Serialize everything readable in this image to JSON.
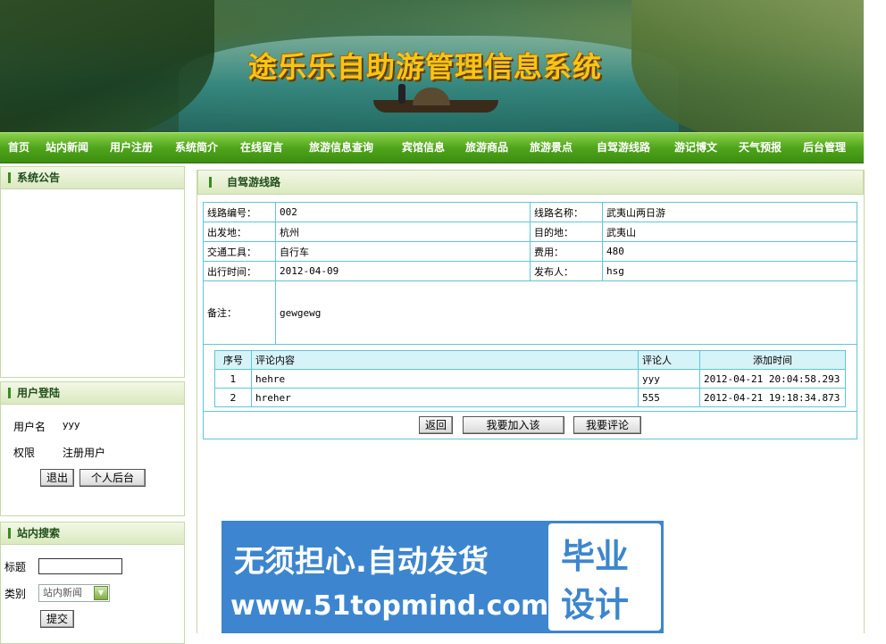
{
  "banner": {
    "title": "途乐乐自助游管理信息系统"
  },
  "nav": [
    "首页",
    "站内新闻",
    "用户注册",
    "系统简介",
    "在线留言",
    "旅游信息查询",
    "宾馆信息",
    "旅游商品",
    "旅游景点",
    "自驾游线路",
    "游记博文",
    "天气预报",
    "后台管理"
  ],
  "notice": {
    "title": "系统公告"
  },
  "login": {
    "title": "用户登陆",
    "username_label": "用户名",
    "username_value": "yyy",
    "role_label": "权限",
    "role_value": "注册用户",
    "logout_btn": "退出",
    "backend_btn": "个人后台"
  },
  "search": {
    "title": "站内搜索",
    "title_label": "标题",
    "type_label": "类别",
    "type_value": "站内新闻",
    "submit_btn": "提交"
  },
  "detail": {
    "title": "自驾游线路",
    "route_no_label": "线路编号：",
    "route_no": "002",
    "route_name_label": "线路名称：",
    "route_name": "武夷山两日游",
    "from_label": "出发地：",
    "from": "杭州",
    "to_label": "目的地：",
    "to": "武夷山",
    "vehicle_label": "交通工具：",
    "vehicle": "自行车",
    "cost_label": "费用：",
    "cost": "480",
    "date_label": "出行时间：",
    "date": "2012-04-09",
    "publisher_label": "发布人：",
    "publisher": "hsg",
    "remark_label": "备注：",
    "remark": "gewgewg"
  },
  "comments": {
    "headers": {
      "no": "序号",
      "content": "评论内容",
      "user": "评论人",
      "time": "添加时间"
    },
    "rows": [
      {
        "no": "1",
        "content": "hehre",
        "user": "yyy",
        "time": "2012-04-21 20:04:58.293"
      },
      {
        "no": "2",
        "content": "hreher",
        "user": "555",
        "time": "2012-04-21 19:18:34.873"
      }
    ]
  },
  "actions": {
    "back": "返回",
    "join": "我要加入该",
    "comment": "我要评论"
  },
  "ad": {
    "line1": "无须担心.自动发货",
    "line2": "www.51topmind.com",
    "box1": "毕业",
    "box2": "设计"
  }
}
